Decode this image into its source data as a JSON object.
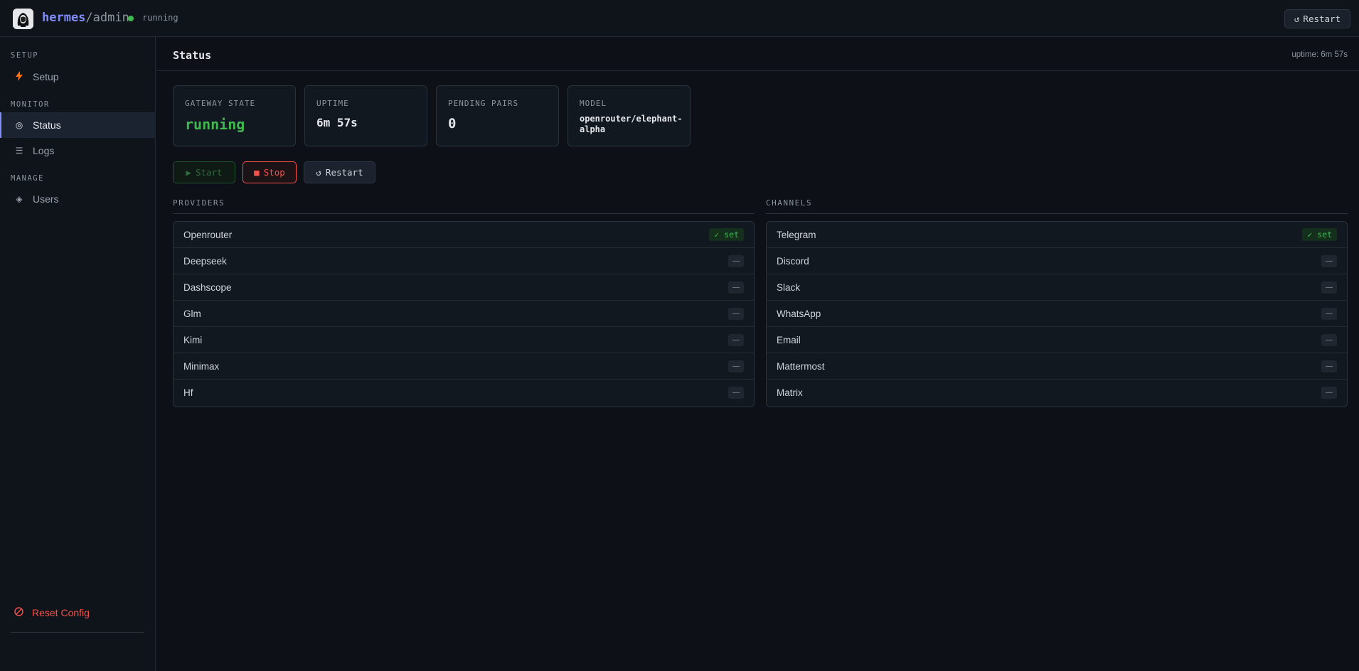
{
  "topbar": {
    "brand_name": "hermes",
    "brand_suffix": "/admin",
    "status": "running",
    "restart_label": "Restart",
    "restart_icon": "refresh-icon"
  },
  "sidebar": {
    "sections": {
      "setup": "SETUP",
      "monitor": "MONITOR",
      "manage": "MANAGE"
    },
    "items": [
      {
        "label": "Setup",
        "icon": "bolt-icon",
        "active": false
      },
      {
        "label": "Status",
        "icon": "target-icon",
        "active": true
      },
      {
        "label": "Logs",
        "icon": "list-icon",
        "active": false
      },
      {
        "label": "Users",
        "icon": "users-icon",
        "active": false
      }
    ],
    "reset_label": "Reset Config",
    "reset_icon": "ban-icon"
  },
  "header": {
    "title": "Status",
    "uptime": "uptime: 6m 57s"
  },
  "cards": [
    {
      "label": "GATEWAY STATE",
      "value": "running"
    },
    {
      "label": "UPTIME",
      "value": "6m 57s"
    },
    {
      "label": "PENDING PAIRS",
      "value": "0"
    },
    {
      "label": "MODEL",
      "value": "openrouter/elephant-alpha"
    }
  ],
  "actions": {
    "start": "Start",
    "stop": "Stop",
    "restart": "Restart"
  },
  "providers": {
    "label": "PROVIDERS",
    "rows": [
      {
        "name": "Openrouter",
        "status": "✓ set"
      },
      {
        "name": "Deepseek",
        "status": "—"
      },
      {
        "name": "Dashscope",
        "status": "—"
      },
      {
        "name": "Glm",
        "status": "—"
      },
      {
        "name": "Kimi",
        "status": "—"
      },
      {
        "name": "Minimax",
        "status": "—"
      },
      {
        "name": "Hf",
        "status": "—"
      }
    ]
  },
  "channels": {
    "label": "CHANNELS",
    "rows": [
      {
        "name": "Telegram",
        "status": "✓ set"
      },
      {
        "name": "Discord",
        "status": "—"
      },
      {
        "name": "Slack",
        "status": "—"
      },
      {
        "name": "WhatsApp",
        "status": "—"
      },
      {
        "name": "Email",
        "status": "—"
      },
      {
        "name": "Mattermost",
        "status": "—"
      },
      {
        "name": "Matrix",
        "status": "—"
      }
    ]
  },
  "colors": {
    "accent": "#818cf8",
    "success": "#3fb950",
    "danger": "#f85149",
    "background": "#0d1117"
  }
}
